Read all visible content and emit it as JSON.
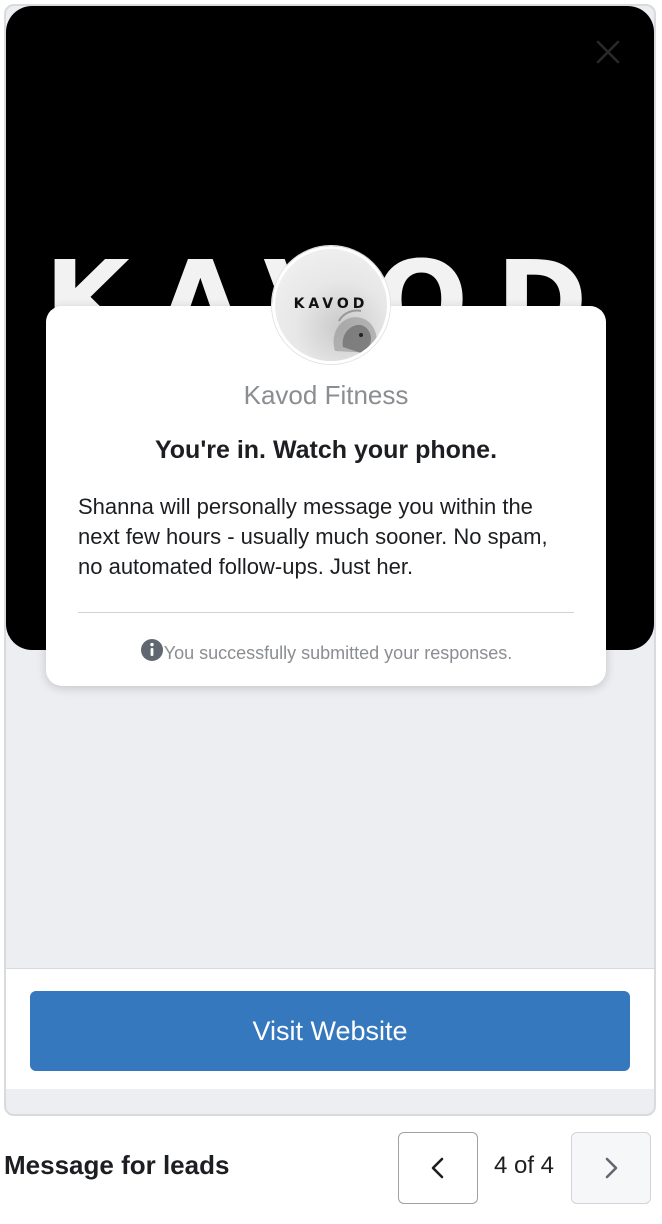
{
  "preview": {
    "hero_word": "KAVOD",
    "close_icon": "close-icon",
    "avatar": {
      "logo_text": "KAVOD",
      "icon": "lion-icon"
    },
    "card": {
      "brand_name": "Kavod Fitness",
      "headline": "You're in. Watch your phone.",
      "body": "Shanna will personally message you within the next few hours - usually much sooner. No spam, no automated follow-ups. Just her.",
      "notice_icon": "info-icon",
      "notice": "You successfully submitted your responses."
    },
    "cta_label": "Visit Website"
  },
  "footer": {
    "title": "Message for leads",
    "pager": {
      "status": "4 of 4",
      "prev_icon": "chevron-left-icon",
      "next_icon": "chevron-right-icon"
    }
  },
  "colors": {
    "accent": "#3578bd",
    "hero_background": "#000000",
    "preview_background": "#edeef2",
    "muted_text": "#8a8d91"
  }
}
